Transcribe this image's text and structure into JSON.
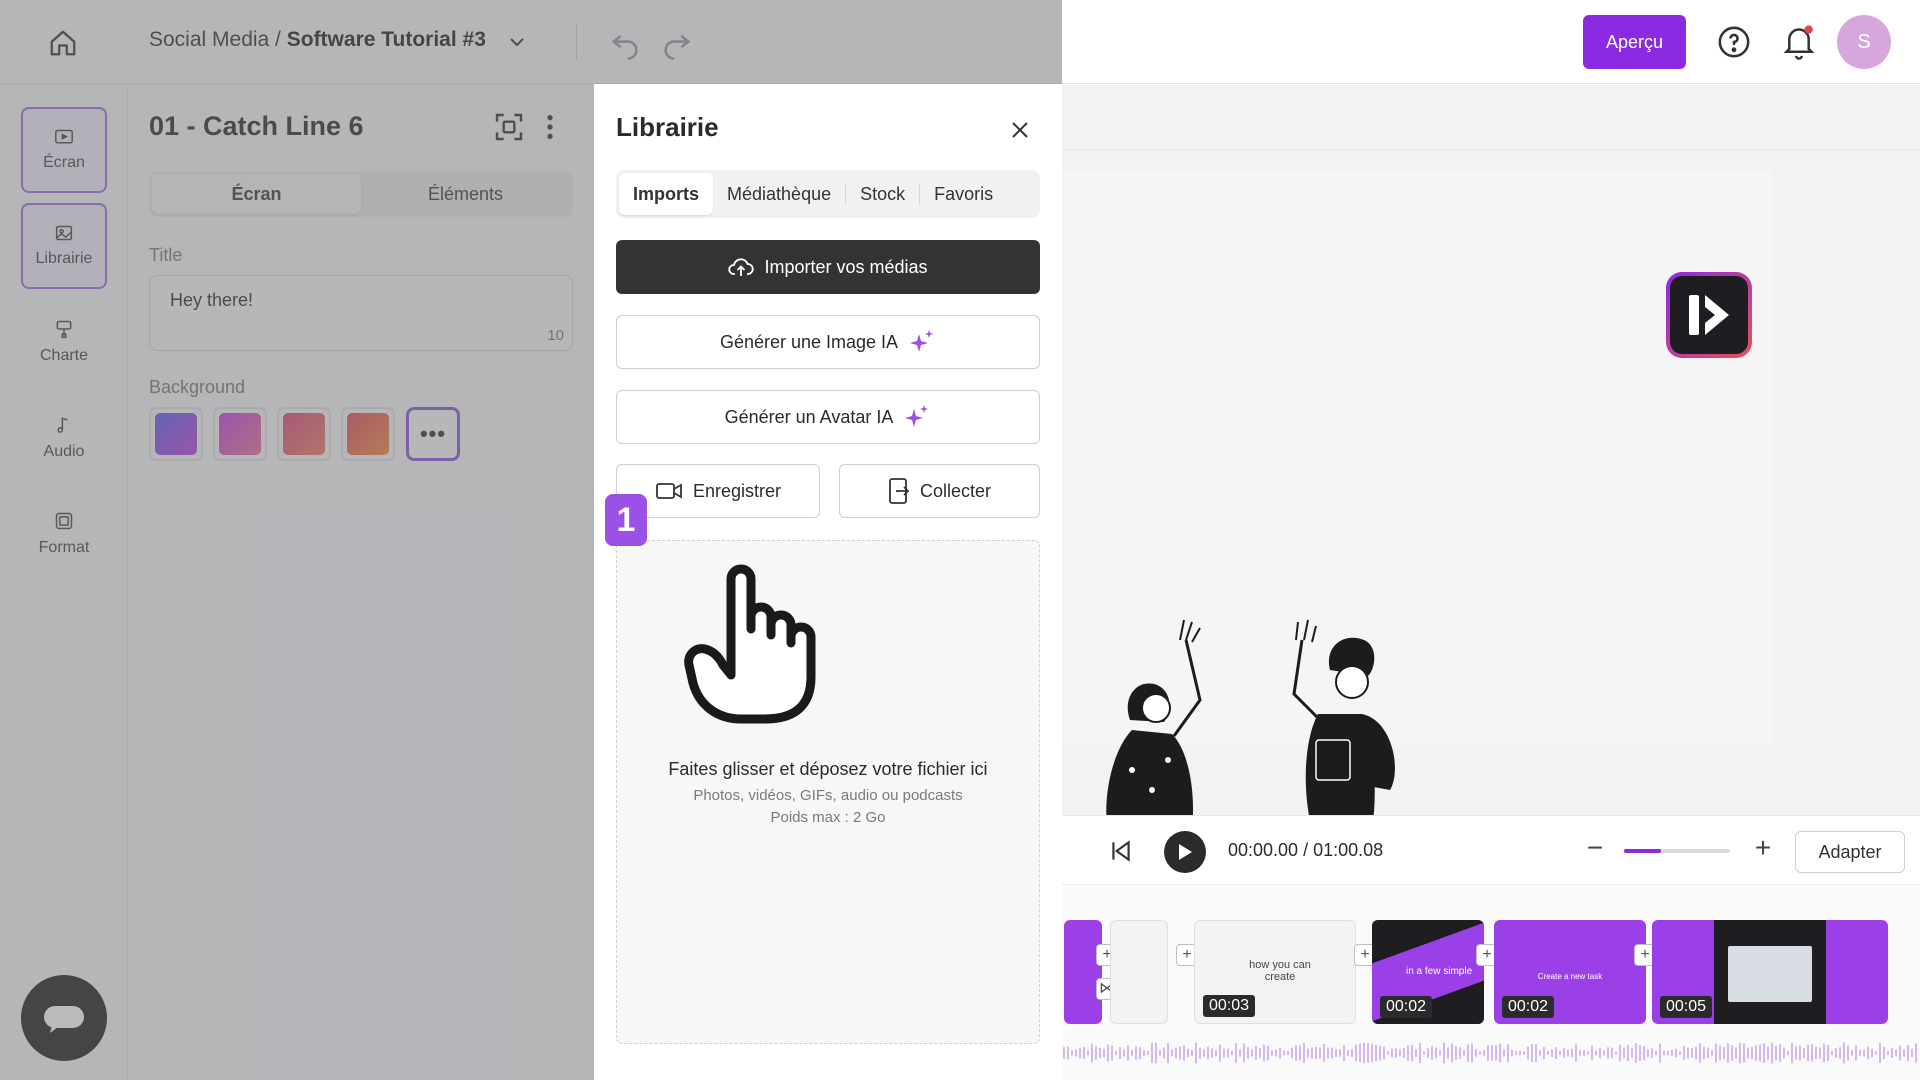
{
  "header": {
    "breadcrumb_prefix": "Social Media / ",
    "project_name": "Software Tutorial #3",
    "preview_button": "Aperçu",
    "avatar_initial": "S"
  },
  "rail": {
    "items": [
      {
        "label": "Écran",
        "icon": "screen-icon",
        "active": true
      },
      {
        "label": "Librairie",
        "icon": "library-icon",
        "active": true
      },
      {
        "label": "Charte",
        "icon": "brand-icon",
        "active": false
      },
      {
        "label": "Audio",
        "icon": "music-note-icon",
        "active": false
      },
      {
        "label": "Format",
        "icon": "frame-icon",
        "active": false
      }
    ]
  },
  "panel": {
    "title": "01 - Catch Line 6",
    "tabs": [
      "Écran",
      "Éléments"
    ],
    "active_tab": "Écran",
    "title_label": "Title",
    "title_value": "Hey there!",
    "title_count": "10",
    "background_label": "Background",
    "swatches": [
      "linear-gradient(135deg,#5b5cf0,#c03fd6)",
      "linear-gradient(135deg,#c23fd8,#e86ea0)",
      "linear-gradient(135deg,#d9457d,#f07d5e)",
      "linear-gradient(135deg,#e24a5e,#f08a3a)"
    ],
    "swatch_more": "•••"
  },
  "library": {
    "title": "Librairie",
    "tabs": [
      "Imports",
      "Médiathèque",
      "Stock",
      "Favoris"
    ],
    "active_tab": "Imports",
    "import_button": "Importer vos médias",
    "gen_image_button": "Générer une Image IA",
    "gen_avatar_button": "Générer un Avatar IA",
    "record_button": "Enregistrer",
    "collect_button": "Collecter",
    "drop_title": "Faites glisser et déposez votre fichier ici",
    "drop_sub1": "Photos, vidéos, GIFs, audio ou podcasts",
    "drop_sub2": "Poids max : 2 Go",
    "step_badge": "1"
  },
  "player": {
    "time": "00:00.00 / 01:00.08",
    "zoom_level": 0.35,
    "adapter_button": "Adapter"
  },
  "timeline": {
    "clips": [
      {
        "duration": "",
        "text": ""
      },
      {
        "duration": "00:03",
        "text": "how you can create"
      },
      {
        "duration": "00:02",
        "text": "in a few simple"
      },
      {
        "duration": "00:02",
        "text": "Create a new task"
      },
      {
        "duration": "00:05",
        "text": ""
      }
    ]
  },
  "colors": {
    "accent": "#8a2be2",
    "badge": "#9b50e6",
    "dark_button": "#333336"
  }
}
